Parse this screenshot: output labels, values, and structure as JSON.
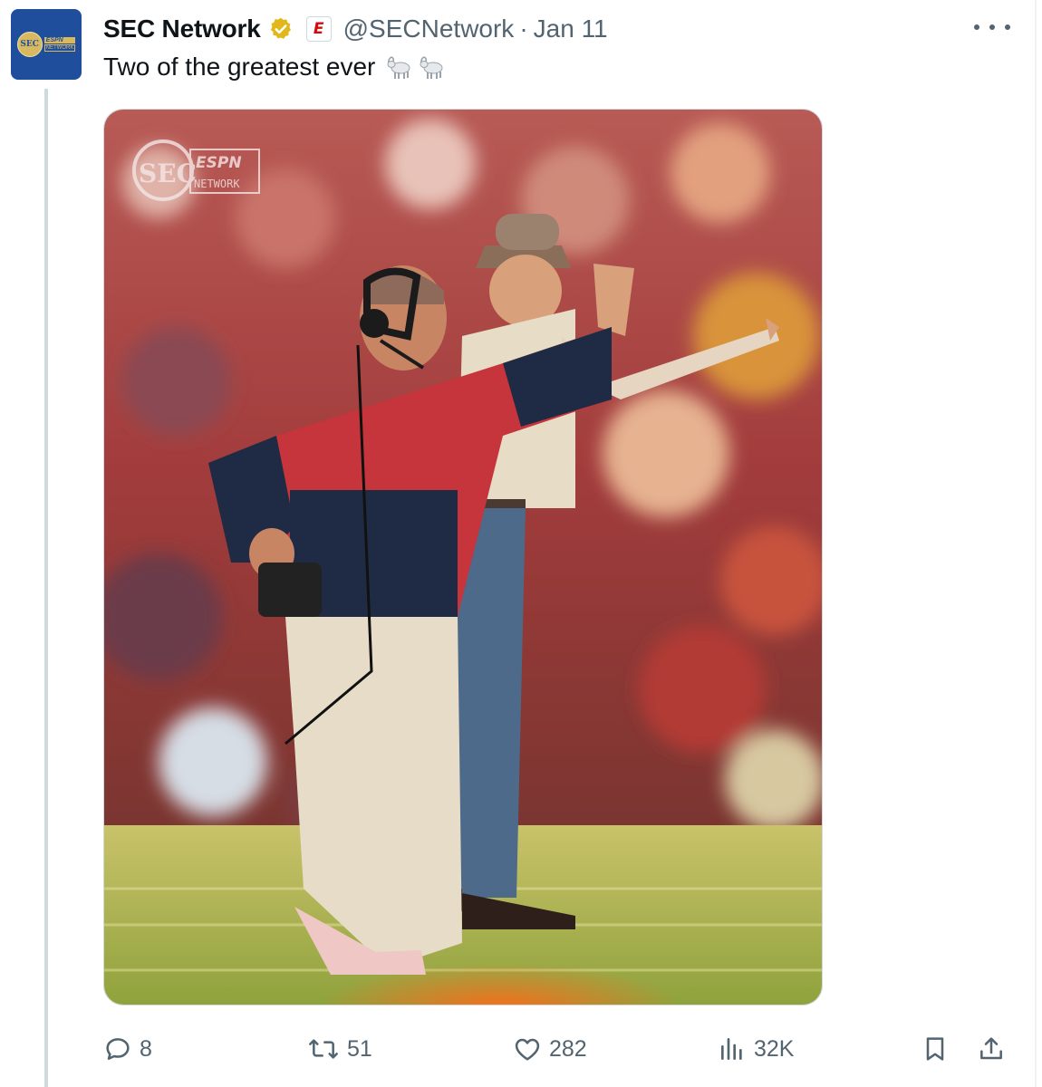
{
  "tweet": {
    "author_name": "SEC Network",
    "handle": "@SECNetwork",
    "separator": "·",
    "timestamp": "Jan 11",
    "text": "Two of the greatest ever",
    "emojis": [
      "goat-icon",
      "goat-icon"
    ],
    "avatar": {
      "logo_text": "SEC",
      "espn_text": "ESPN",
      "network_text": "NETWORK",
      "bg_color": "#1f4f9c",
      "accent_color": "#d9b960"
    },
    "affiliate_badge": {
      "letter": "E",
      "color": "#d50a0a"
    },
    "verified_color": "#e2b719"
  },
  "media": {
    "watermark": {
      "logo_text": "SEC",
      "espn_text": "ESPN",
      "network_text": "NETWORK"
    }
  },
  "actions": {
    "replies": "8",
    "reposts": "51",
    "likes": "282",
    "views": "32K",
    "icons": [
      "reply-icon",
      "repost-icon",
      "like-icon",
      "views-icon",
      "bookmark-icon",
      "share-icon"
    ]
  }
}
